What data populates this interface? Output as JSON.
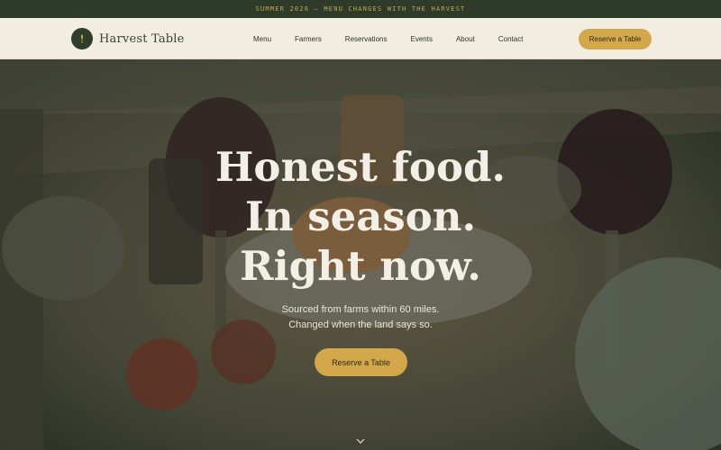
{
  "announcement": {
    "text": "SUMMER 2026 — MENU CHANGES WITH THE HARVEST"
  },
  "brand": {
    "name": "Harvest Table",
    "logo_icon": "wheat-icon",
    "logo_lettering": "HARVEST"
  },
  "nav": {
    "items": [
      {
        "label": "Menu"
      },
      {
        "label": "Farmers"
      },
      {
        "label": "Reservations"
      },
      {
        "label": "Events"
      },
      {
        "label": "About"
      },
      {
        "label": "Contact"
      }
    ],
    "cta_label": "Reserve a Table"
  },
  "hero": {
    "headline": [
      "Honest food.",
      "In season.",
      "Right now."
    ],
    "subtext": [
      "Sourced from farms within 60 miles.",
      "Changed when the land says so."
    ],
    "cta_label": "Reserve a Table",
    "scroll_icon": "chevron-down-icon"
  },
  "colors": {
    "accent": "#d3a84a",
    "dark_green": "#2e3b2a",
    "cream": "#f2ece1",
    "headline_text": "#f4efe6"
  }
}
